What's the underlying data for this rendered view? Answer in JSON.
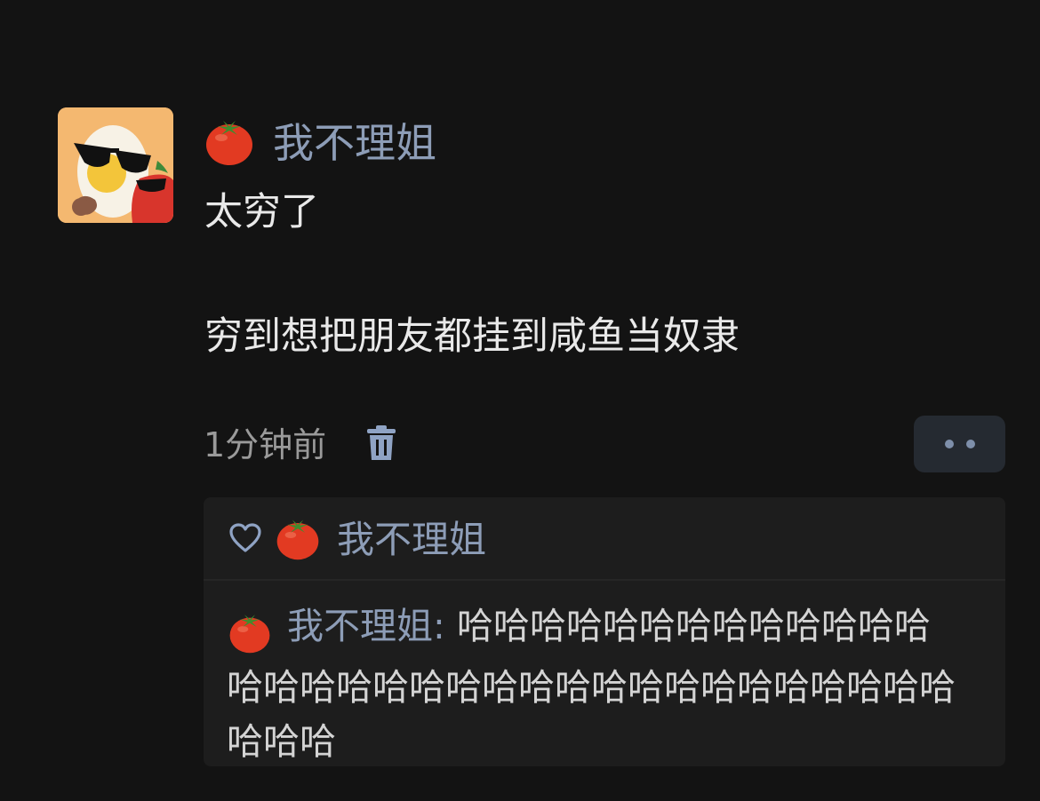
{
  "post": {
    "author_emoji": "tomato",
    "author_name": "我不理姐",
    "content_line1": "太穷了",
    "content_line2": "穷到想把朋友都挂到咸鱼当奴隶",
    "time": "1分钟前"
  },
  "icons": {
    "avatar": "avatar-image",
    "delete": "trash-icon",
    "more": "more-dots-icon",
    "like": "heart-outline-icon"
  },
  "likes": {
    "names": [
      "我不理姐"
    ]
  },
  "comments": [
    {
      "author": "我不理姐",
      "separator": ": ",
      "text": "哈哈哈哈哈哈哈哈哈哈哈哈哈哈哈哈哈哈哈哈哈哈哈哈哈哈哈哈哈哈哈哈哈哈哈哈"
    }
  ],
  "colors": {
    "background": "#131313",
    "username": "#8d9db7",
    "text": "#e9e9e9",
    "time": "#9a9a9a",
    "reply_box": "#1d1d1d"
  }
}
